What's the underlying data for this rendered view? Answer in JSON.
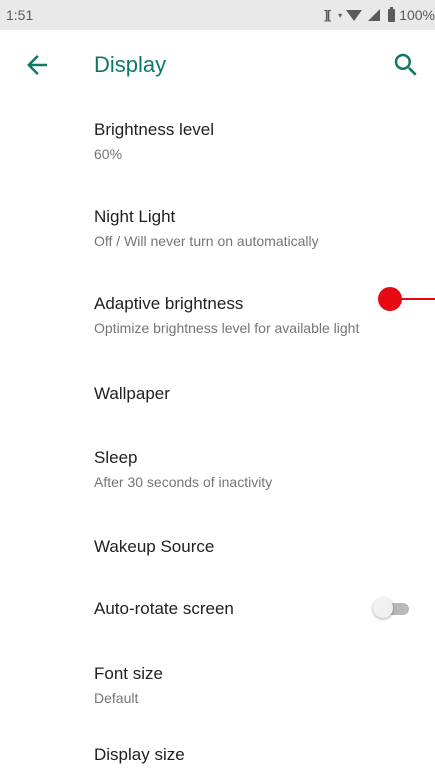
{
  "status_bar": {
    "time": "1:51",
    "battery": "100%",
    "icons": [
      "scan-icon",
      "data-arrows-icon",
      "wifi-icon",
      "cell-signal-icon",
      "battery-icon"
    ]
  },
  "toolbar": {
    "title": "Display",
    "back_icon": "arrow-left-icon",
    "search_icon": "search-icon",
    "accent_color": "#0d7a65"
  },
  "settings": {
    "items": [
      {
        "title": "Brightness level",
        "summary": "60%"
      },
      {
        "title": "Night Light",
        "summary": "Off / Will never turn on automatically"
      },
      {
        "title": "Adaptive brightness",
        "summary": "Optimize brightness level for available light"
      },
      {
        "title": "Wallpaper"
      },
      {
        "title": "Sleep",
        "summary": "After 30 seconds of inactivity"
      },
      {
        "title": "Wakeup Source"
      },
      {
        "title": "Auto-rotate screen",
        "toggle": "off"
      },
      {
        "title": "Font size",
        "summary": "Default"
      },
      {
        "title": "Display size"
      }
    ]
  },
  "touch_indicator_color": "#e50914"
}
